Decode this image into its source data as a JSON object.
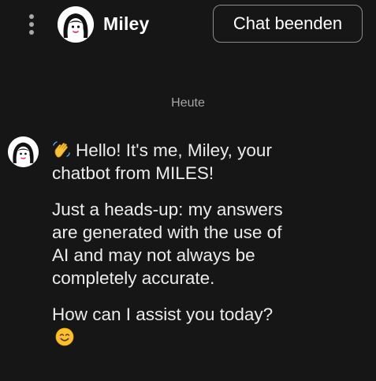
{
  "header": {
    "bot_name": "Miley",
    "end_chat_label": "Chat beenden"
  },
  "date_separator": "Heute",
  "message": {
    "greeting": "Hello! It's me, Miley, your chatbot from MILES!",
    "disclaimer": "Just a heads-up: my answers are generated with the use of AI and may not always be completely accurate.",
    "question": "How can I assist you today?"
  },
  "icons": {
    "menu": "more-vertical-icon",
    "avatar": "miley-avatar-icon",
    "wave": "waving-hand-emoji",
    "smile": "smiling-face-emoji"
  },
  "colors": {
    "background": "#161616",
    "text": "#ececec",
    "button_border": "#8c8c8c"
  }
}
